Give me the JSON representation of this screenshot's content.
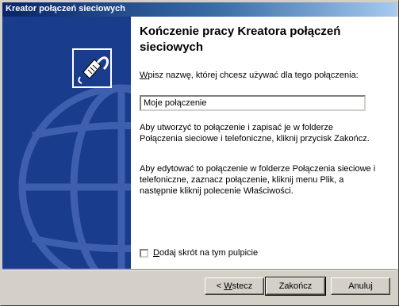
{
  "window": {
    "title": "Kreator połączeń sieciowych"
  },
  "heading": "Kończenie pracy Kreatora połączeń sieciowych",
  "name_prompt": {
    "access_key": "W",
    "rest": "pisz nazwę, której chcesz używać dla tego połączenia:"
  },
  "connection_name_input": {
    "value": "Moje połączenie"
  },
  "paragraph_save": "Aby utworzyć to połączenie i zapisać je w folderze Połączenia sieciowe i telefoniczne, kliknij przycisk Zakończ.",
  "paragraph_edit": "Aby edytować to połączenie w folderze Połączenia sieciowe i telefoniczne, zaznacz połączenie, kliknij menu Plik, a następnie kliknij polecenie Właściwości.",
  "shortcut_checkbox": {
    "checked": false,
    "access_key": "D",
    "rest": "odaj skrót na tym pulpicie"
  },
  "buttons": {
    "back_prefix": "< ",
    "back_key": "W",
    "back_rest": "stecz",
    "finish": "Zakończ",
    "cancel": "Anuluj"
  },
  "side_panel": {
    "color": "#1a3c8c",
    "icon": "network-cable-icon"
  }
}
